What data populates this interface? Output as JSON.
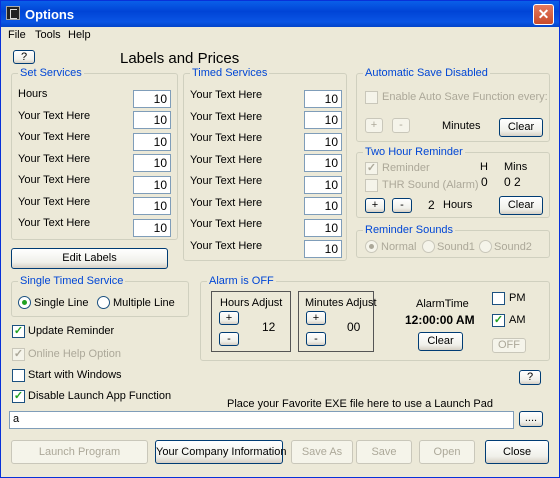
{
  "window": {
    "title": "Options",
    "close_glyph": "✕"
  },
  "menu": {
    "file": "File",
    "tools": "Tools",
    "help": "Help"
  },
  "top_help_button": "?",
  "heading": "Labels and Prices",
  "set_services": {
    "title": "Set Services",
    "rows": [
      {
        "label": "Hours",
        "value": "10"
      },
      {
        "label": "Your Text Here",
        "value": "10"
      },
      {
        "label": "Your Text Here",
        "value": "10"
      },
      {
        "label": "Your Text Here",
        "value": "10"
      },
      {
        "label": "Your Text Here",
        "value": "10"
      },
      {
        "label": "Your Text Here",
        "value": "10"
      },
      {
        "label": "Your Text Here",
        "value": "10"
      }
    ]
  },
  "timed_services": {
    "title": "Timed Services",
    "rows": [
      {
        "label": "Your Text Here",
        "value": "10"
      },
      {
        "label": "Your Text Here",
        "value": "10"
      },
      {
        "label": "Your Text Here",
        "value": "10"
      },
      {
        "label": "Your Text Here",
        "value": "10"
      },
      {
        "label": "Your Text Here",
        "value": "10"
      },
      {
        "label": "Your Text Here",
        "value": "10"
      },
      {
        "label": "Your Text Here",
        "value": "10"
      },
      {
        "label": "Your Text Here",
        "value": "10"
      }
    ]
  },
  "edit_labels_button": "Edit Labels",
  "auto_save": {
    "title": "Automatic Save Disabled",
    "enable_label": "Enable Auto Save Function every:",
    "plus": "+",
    "minus": "-",
    "minutes_label": "Minutes",
    "clear": "Clear"
  },
  "two_hour": {
    "title": "Two Hour Reminder",
    "reminder_label": "Reminder",
    "thr_sound_label": "THR Sound (Alarm)",
    "h_header": "H",
    "mins_header": "Mins",
    "h_value": "0",
    "mins_value": "0 2",
    "plus": "+",
    "minus": "-",
    "hours_value": "2",
    "hours_label": "Hours",
    "clear": "Clear"
  },
  "reminder_sounds": {
    "title": "Reminder Sounds",
    "options": [
      "Normal",
      "Sound1",
      "Sound2"
    ],
    "selected": "Normal"
  },
  "single_timed": {
    "title": "Single Timed Service",
    "options": [
      "Single Line",
      "Multiple Line"
    ],
    "selected": "Single Line"
  },
  "checkboxes": {
    "update_reminder": {
      "label": "Update Reminder",
      "checked": true
    },
    "online_help": {
      "label": "Online Help Option",
      "checked": true
    },
    "start_windows": {
      "label": "Start with Windows",
      "checked": false
    },
    "disable_launch": {
      "label": "Disable Launch App Function",
      "checked": true
    }
  },
  "alarm": {
    "title": "Alarm is OFF",
    "hours_adjust": "Hours Adjust",
    "minutes_adjust": "Minutes Adjust",
    "plus": "+",
    "minus": "-",
    "hours_value": "12",
    "minutes_value": "00",
    "alarm_time_label": "AlarmTime",
    "alarm_time_value": "12:00:00 AM",
    "pm_label": "PM",
    "pm_checked": false,
    "am_label": "AM",
    "am_checked": true,
    "clear": "Clear",
    "off": "OFF"
  },
  "small_help_button": "?",
  "launch_prompt": "Place your Favorite EXE file here to use a Launch Pad",
  "launch_path_value": "a",
  "browse_button": "....",
  "bottom_buttons": {
    "launch": "Launch Program",
    "company": "Your Company Information",
    "save_as": "Save As",
    "save": "Save",
    "open": "Open",
    "close": "Close"
  }
}
